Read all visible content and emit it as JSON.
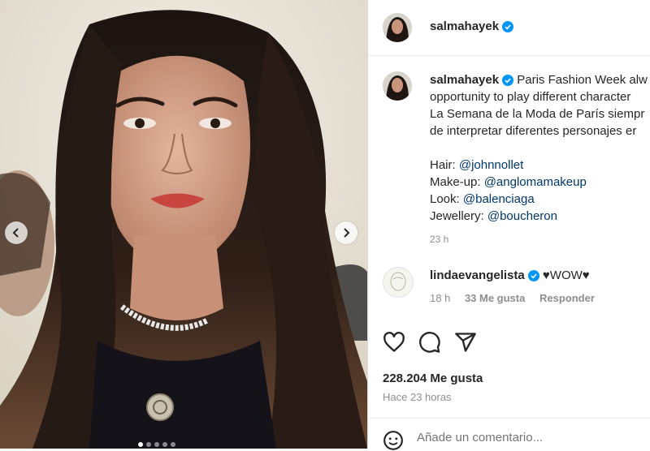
{
  "post": {
    "username": "salmahayek",
    "caption_lines": [
      "Paris Fashion Week alw",
      "opportunity to play different character",
      "La Semana de la Moda de París siempr",
      "de interpretar diferentes personajes er"
    ],
    "credits": [
      {
        "label": "Hair: ",
        "handle": "@johnnollet"
      },
      {
        "label": "Make-up: ",
        "handle": "@anglomamakeup"
      },
      {
        "label": "Look: ",
        "handle": "@balenciaga"
      },
      {
        "label": "Jewellery: ",
        "handle": "@boucheron"
      }
    ],
    "caption_time": "23 h"
  },
  "comment": {
    "username": "lindaevangelista",
    "text": "♥WOW♥",
    "time": "18 h",
    "likes": "33 Me gusta",
    "reply": "Responder"
  },
  "stats": {
    "likes": "228.204 Me gusta",
    "time_ago": "Hace 23 horas"
  },
  "input": {
    "placeholder": "Añade un comentario..."
  },
  "carousel": {
    "slides": 5,
    "active": 1
  },
  "colors": {
    "verified": "#0095f6",
    "link": "#00376b",
    "muted": "#8e8e8e",
    "lipstick": "#c8463f"
  },
  "icons": [
    "verified-icon",
    "heart-icon",
    "comment-icon",
    "share-icon",
    "emoji-icon",
    "chevron-left-icon",
    "chevron-right-icon"
  ]
}
